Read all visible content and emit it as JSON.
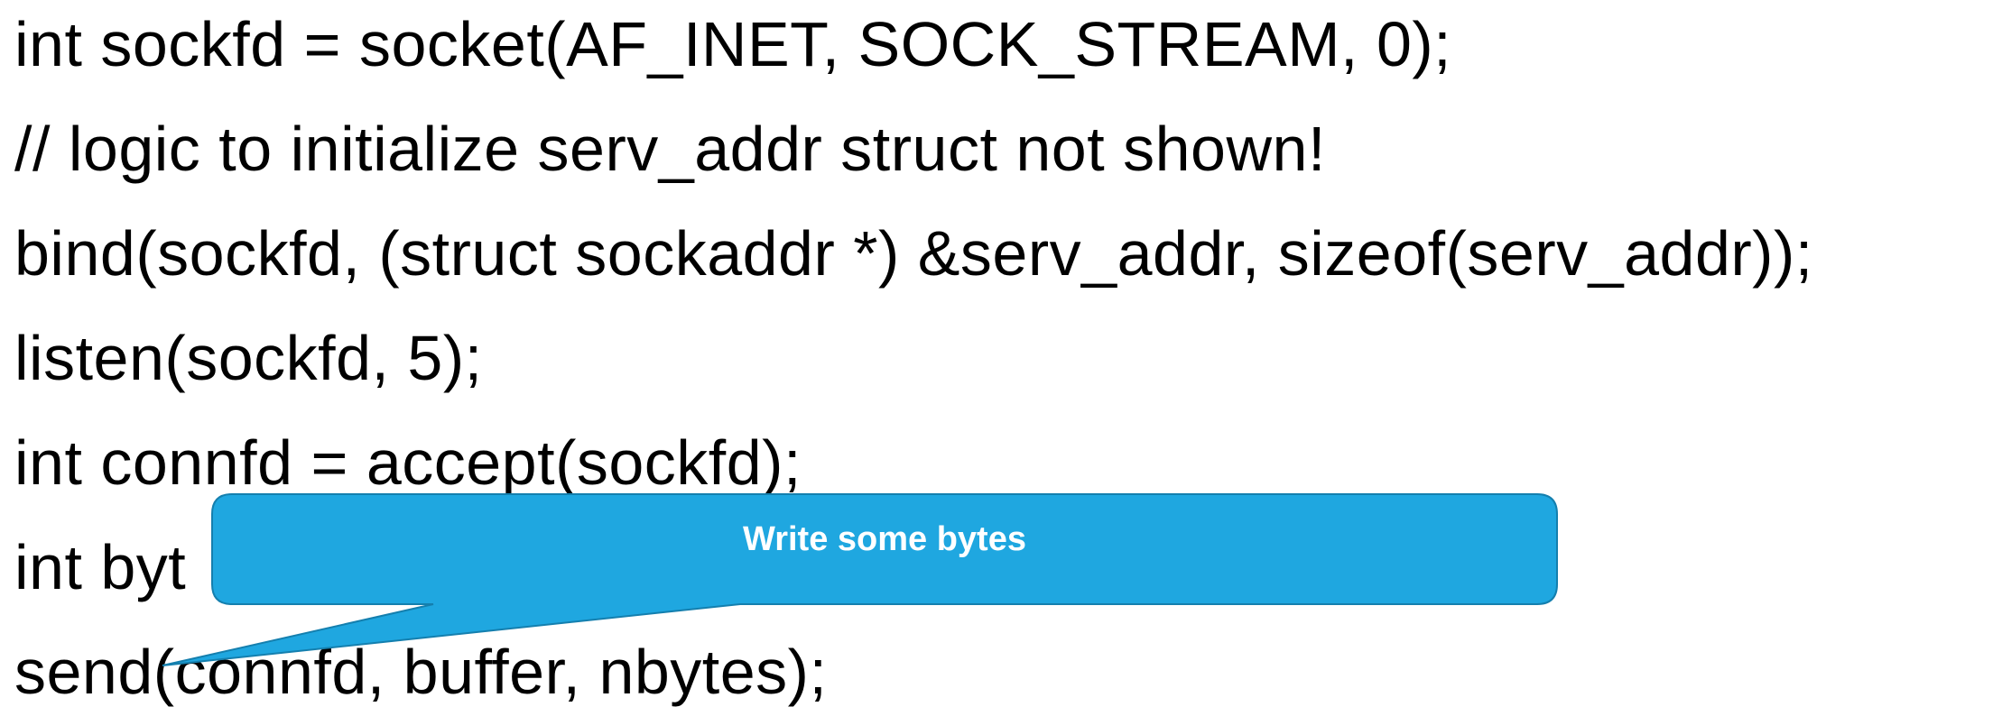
{
  "code": {
    "lines": [
      "int sockfd = socket(AF_INET, SOCK_STREAM, 0);",
      "// logic to initialize serv_addr struct not shown!",
      "bind(sockfd, (struct sockaddr *) &serv_addr, sizeof(serv_addr));",
      "listen(sockfd, 5);",
      "int connfd = accept(sockfd);",
      "int byt",
      "send(connfd, buffer, nbytes);"
    ]
  },
  "callout": {
    "text": "Write some bytes",
    "fill_color": "#1fa7e0",
    "border_color": "#147fae"
  }
}
